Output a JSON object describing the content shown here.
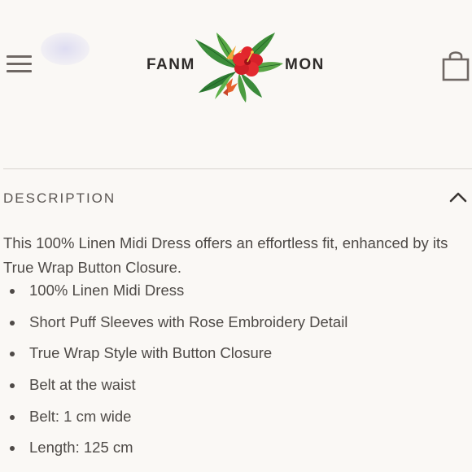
{
  "header": {
    "menu_icon": "hamburger-menu-icon",
    "logo": {
      "left_text": "FANM",
      "right_text": "MON",
      "art_icon": "tropical-flower-icon"
    },
    "cart_icon": "shopping-bag-icon"
  },
  "description": {
    "title": "DESCRIPTION",
    "toggle_icon": "chevron-up-icon",
    "intro": "This 100% Linen Midi Dress offers an effortless fit, enhanced by its True Wrap Button Closure.",
    "bullets": [
      "100% Linen Midi Dress",
      "Short Puff Sleeves with Rose Embroidery Detail",
      "True Wrap Style with Button Closure",
      "Belt at the waist",
      "Belt: 1 cm wide",
      "Length: 125 cm"
    ]
  },
  "colors": {
    "background": "#faf8f5",
    "text": "#4e4a47",
    "icon": "#6f6864",
    "hibiscus": "#d8232a",
    "leaf": "#3f8f3a"
  }
}
